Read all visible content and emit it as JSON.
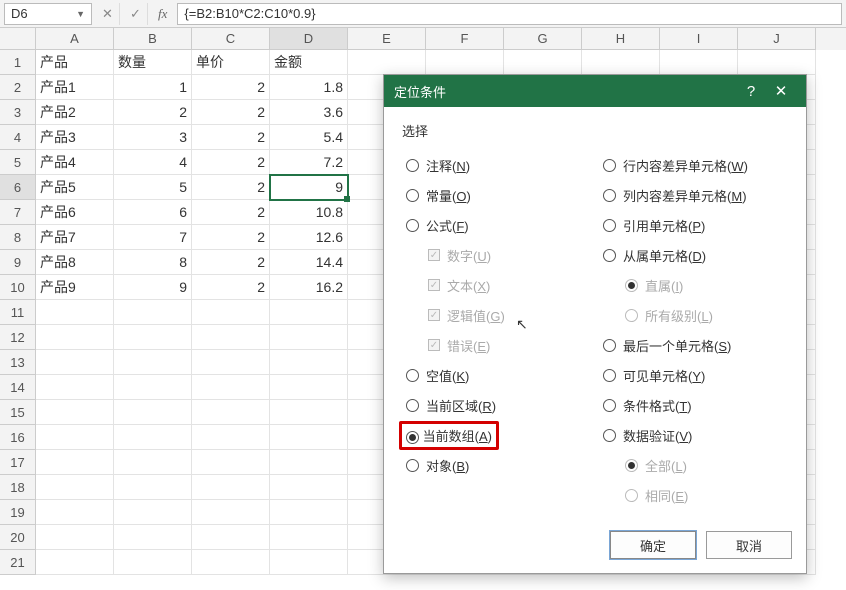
{
  "namebox": "D6",
  "formula": "{=B2:B10*C2:C10*0.9}",
  "columns": [
    "A",
    "B",
    "C",
    "D",
    "E",
    "F",
    "G",
    "H",
    "I",
    "J"
  ],
  "rows": [
    1,
    2,
    3,
    4,
    5,
    6,
    7,
    8,
    9,
    10,
    11,
    12,
    13,
    14,
    15,
    16,
    17,
    18,
    19,
    20,
    21
  ],
  "active": {
    "row": 6,
    "col": "D"
  },
  "data": {
    "headers": [
      "产品",
      "数量",
      "单价",
      "金额"
    ],
    "body": [
      [
        "产品1",
        1,
        2,
        "1.8"
      ],
      [
        "产品2",
        2,
        2,
        "3.6"
      ],
      [
        "产品3",
        3,
        2,
        "5.4"
      ],
      [
        "产品4",
        4,
        2,
        "7.2"
      ],
      [
        "产品5",
        5,
        2,
        "9"
      ],
      [
        "产品6",
        6,
        2,
        "10.8"
      ],
      [
        "产品7",
        7,
        2,
        "12.6"
      ],
      [
        "产品8",
        8,
        2,
        "14.4"
      ],
      [
        "产品9",
        9,
        2,
        "16.2"
      ]
    ]
  },
  "dialog": {
    "title": "定位条件",
    "section": "选择",
    "left": [
      {
        "key": "n",
        "label": "注释",
        "hot": "N",
        "type": "radio",
        "checked": false
      },
      {
        "key": "o",
        "label": "常量",
        "hot": "O",
        "type": "radio",
        "checked": false
      },
      {
        "key": "f",
        "label": "公式",
        "hot": "F",
        "type": "radio",
        "checked": false
      },
      {
        "key": "u",
        "label": "数字",
        "hot": "U",
        "type": "check",
        "disabled": true,
        "sub": true
      },
      {
        "key": "x",
        "label": "文本",
        "hot": "X",
        "type": "check",
        "disabled": true,
        "sub": true
      },
      {
        "key": "g",
        "label": "逻辑值",
        "hot": "G",
        "type": "check",
        "disabled": true,
        "sub": true
      },
      {
        "key": "e",
        "label": "错误",
        "hot": "E",
        "type": "check",
        "disabled": true,
        "sub": true
      },
      {
        "key": "k",
        "label": "空值",
        "hot": "K",
        "type": "radio",
        "checked": false
      },
      {
        "key": "r",
        "label": "当前区域",
        "hot": "R",
        "type": "radio",
        "checked": false
      },
      {
        "key": "a",
        "label": "当前数组",
        "hot": "A",
        "type": "radio",
        "checked": true,
        "highlight": true
      },
      {
        "key": "b",
        "label": "对象",
        "hot": "B",
        "type": "radio",
        "checked": false
      }
    ],
    "right": [
      {
        "key": "w",
        "label": "行内容差异单元格",
        "hot": "W",
        "type": "radio",
        "checked": false
      },
      {
        "key": "m",
        "label": "列内容差异单元格",
        "hot": "M",
        "type": "radio",
        "checked": false
      },
      {
        "key": "p",
        "label": "引用单元格",
        "hot": "P",
        "type": "radio",
        "checked": false
      },
      {
        "key": "d",
        "label": "从属单元格",
        "hot": "D",
        "type": "radio",
        "checked": false
      },
      {
        "key": "i",
        "label": "直属",
        "hot": "I",
        "type": "radio",
        "disabled": true,
        "sub": true,
        "checked": true
      },
      {
        "key": "l1",
        "label": "所有级别",
        "hot": "L",
        "type": "radio",
        "disabled": true,
        "sub": true,
        "checked": false
      },
      {
        "key": "s",
        "label": "最后一个单元格",
        "hot": "S",
        "type": "radio",
        "checked": false
      },
      {
        "key": "y",
        "label": "可见单元格",
        "hot": "Y",
        "type": "radio",
        "checked": false
      },
      {
        "key": "t",
        "label": "条件格式",
        "hot": "T",
        "type": "radio",
        "checked": false
      },
      {
        "key": "v",
        "label": "数据验证",
        "hot": "V",
        "type": "radio",
        "checked": false
      },
      {
        "key": "l2",
        "label": "全部",
        "hot": "L",
        "type": "radio",
        "disabled": true,
        "sub": true,
        "checked": true
      },
      {
        "key": "e2",
        "label": "相同",
        "hot": "E",
        "type": "radio",
        "disabled": true,
        "sub": true,
        "checked": false
      }
    ],
    "ok": "确定",
    "cancel": "取消",
    "help": "?"
  }
}
